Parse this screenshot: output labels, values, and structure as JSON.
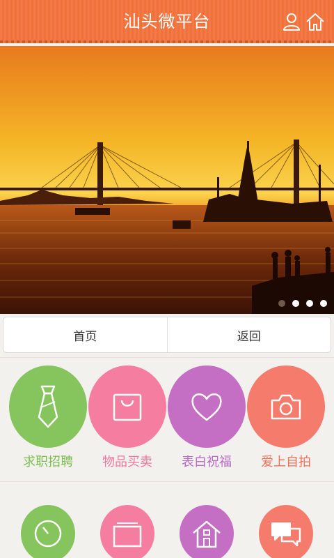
{
  "header": {
    "title": "汕头微平台",
    "user_icon": "user-icon",
    "home_icon": "home-icon",
    "color": "#f47a45"
  },
  "banner": {
    "total_slides": 4,
    "active_slide": 1
  },
  "tabs": [
    {
      "label": "首页"
    },
    {
      "label": "返回"
    }
  ],
  "grid": {
    "row1": [
      {
        "label": "求职招聘",
        "icon": "tie-icon",
        "bg": "#86c45e",
        "color": "#7bbd4f"
      },
      {
        "label": "物品买卖",
        "icon": "shopping-bag-icon",
        "bg": "#f57ea0",
        "color": "#f176a0"
      },
      {
        "label": "表白祝福",
        "icon": "heart-icon",
        "bg": "#c46fc4",
        "color": "#b86cc8"
      },
      {
        "label": "爱上自拍",
        "icon": "camera-icon",
        "bg": "#f57b6d",
        "color": "#f27058"
      }
    ],
    "row2": [
      {
        "icon": "clock-icon",
        "bg": "#86c45e"
      },
      {
        "icon": "folder-icon",
        "bg": "#f57ea0"
      },
      {
        "icon": "house-icon",
        "bg": "#c46fc4"
      },
      {
        "icon": "chat-icon",
        "bg": "#f57b6d"
      }
    ]
  }
}
